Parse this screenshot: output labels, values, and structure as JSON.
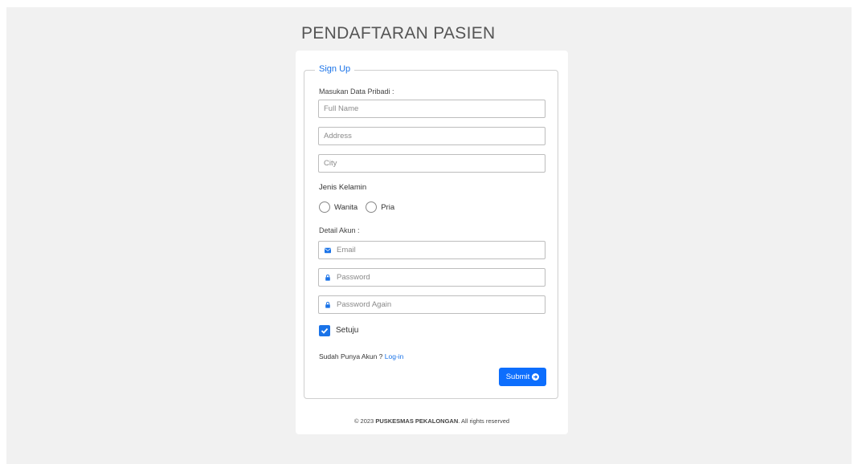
{
  "page": {
    "title": "PENDAFTARAN PASIEN"
  },
  "form": {
    "legend": "Sign Up",
    "personal_label": "Masukan Data Pribadi :",
    "full_name_placeholder": "Full Name",
    "address_placeholder": "Address",
    "city_placeholder": "City",
    "gender_label": "Jenis Kelamin",
    "gender_options": [
      "Wanita",
      "Pria"
    ],
    "account_label": "Detail Akun :",
    "email_placeholder": "Email",
    "password_placeholder": "Password",
    "password_again_placeholder": "Password Again",
    "agree_label": "Setuju",
    "agree_checked": true,
    "have_account_text": "Sudah Punya Akun ?",
    "login_link": "Log-in",
    "submit_label": "Submit"
  },
  "footer": {
    "prefix": "© 2023",
    "brand": "PUSKESMAS PEKALONGAN",
    "suffix": ". All rights reserved"
  },
  "colors": {
    "accent": "#1a73e8",
    "button": "#0d6efd",
    "background": "#f1f1f1"
  },
  "icons": {
    "email": "envelope-icon",
    "password": "lock-icon",
    "submit": "arrow-circle-right-icon",
    "checkbox": "checkmark-icon"
  }
}
